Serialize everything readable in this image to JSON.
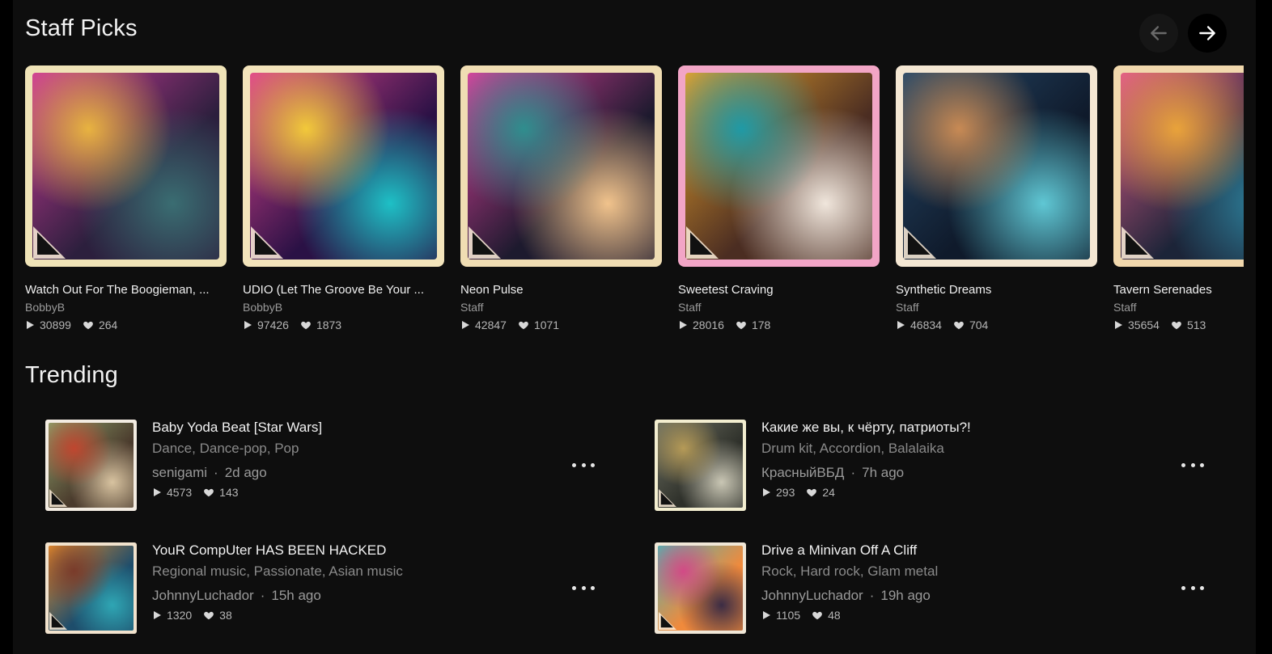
{
  "staff_picks": {
    "title": "Staff Picks",
    "prev_icon": "arrow-left-icon",
    "next_icon": "arrow-right-icon",
    "cards": [
      {
        "title": "Watch Out For The Boogieman, ...",
        "artist": "BobbyB",
        "plays": "30899",
        "likes": "264",
        "frame": "#efe3b7",
        "art": [
          "#2c1f3d",
          "#d03a9a",
          "#e8b340",
          "#3a6d72"
        ]
      },
      {
        "title": "UDIO (Let The Groove Be Your ...",
        "artist": "BobbyB",
        "plays": "97426",
        "likes": "1873",
        "frame": "#f3e4bb",
        "art": [
          "#2a1145",
          "#e2458f",
          "#f2c93a",
          "#1ec0c6"
        ]
      },
      {
        "title": "Neon Pulse",
        "artist": "Staff",
        "plays": "42847",
        "likes": "1071",
        "frame": "#f0ddb3",
        "art": [
          "#1d1a2e",
          "#e0409e",
          "#2f8e8e",
          "#f1c38c"
        ]
      },
      {
        "title": "Sweetest Craving",
        "artist": "Staff",
        "plays": "28016",
        "likes": "178",
        "frame": "#f2a5c6",
        "art": [
          "#4b2d22",
          "#e8a32c",
          "#1f9aa6",
          "#f0e6dc"
        ]
      },
      {
        "title": "Synthetic Dreams",
        "artist": "Staff",
        "plays": "46834",
        "likes": "704",
        "frame": "#f4e7d3",
        "art": [
          "#0f1a2b",
          "#274a6a",
          "#c88a54",
          "#5fc7d4"
        ]
      },
      {
        "title": "Tavern Serenades",
        "artist": "Staff",
        "plays": "35654",
        "likes": "513",
        "frame": "#f1d8ad",
        "art": [
          "#1c2438",
          "#e45d8a",
          "#e9a33a",
          "#2d7f9a"
        ]
      }
    ]
  },
  "trending": {
    "title": "Trending",
    "more_icon": "more-horizontal-icon",
    "items": [
      {
        "title": "Baby Yoda Beat [Star Wars]",
        "genres": "Dance, Dance-pop, Pop",
        "artist": "senigami",
        "dot": "·",
        "time": "2d ago",
        "plays": "4573",
        "likes": "143",
        "frame": "#f3ece2",
        "art": [
          "#4a3a2c",
          "#8da06a",
          "#c0462f",
          "#d8c3a0"
        ]
      },
      {
        "title": "Какие же вы, к чёрту, патриоты?!",
        "genres": "Drum kit, Accordion, Balalaika",
        "artist": "КрасныйВБД",
        "dot": "·",
        "time": "7h ago",
        "plays": "293",
        "likes": "24",
        "frame": "#f3eed0",
        "art": [
          "#2e302a",
          "#6f7263",
          "#b59a57",
          "#c9c6b4"
        ]
      },
      {
        "title": "YouR CompUter HAS BEEN HACKED",
        "genres": "Regional music, Passionate, Asian music",
        "artist": "JohnnyLuchador",
        "dot": "·",
        "time": "15h ago",
        "plays": "1320",
        "likes": "38",
        "frame": "#f1e2cd",
        "art": [
          "#1e4d6b",
          "#e38a2c",
          "#7a3b2a",
          "#2fa6b4"
        ]
      },
      {
        "title": "Drive a Minivan Off A Cliff",
        "genres": "Rock, Hard rock, Glam metal",
        "artist": "JohnnyLuchador",
        "dot": "·",
        "time": "19h ago",
        "plays": "1105",
        "likes": "48",
        "frame": "#f0e7d7",
        "art": [
          "#f08a3c",
          "#52b3b0",
          "#d24a86",
          "#3b2c44"
        ]
      }
    ]
  }
}
